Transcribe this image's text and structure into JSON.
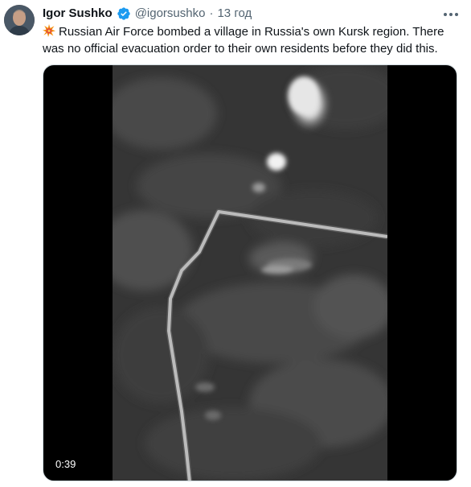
{
  "tweet": {
    "author": {
      "display_name": "Igor Sushko",
      "handle": "@igorsushko",
      "verified": true,
      "avatar_icon": "user-avatar"
    },
    "separator": "·",
    "time": "13 год",
    "text": "Russian Air Force bombed a village in Russia's own Kursk region. There was no official evacuation order to their own residents before they did this.",
    "emoji_icon": "collision-emoji-icon",
    "media": {
      "type": "video",
      "duration": "0:39"
    }
  },
  "colors": {
    "verified_blue": "#1d9bf0",
    "secondary_text": "#536471",
    "primary_text": "#0f1419",
    "border": "#cfd9de"
  }
}
